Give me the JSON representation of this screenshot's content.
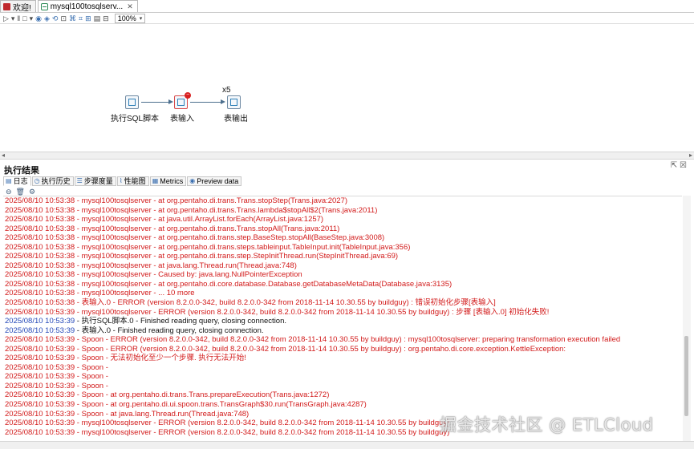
{
  "tabs": [
    {
      "label": "欢迎!",
      "icon": "welcome-icon"
    },
    {
      "label": "mysql100tosqlserv...",
      "icon": "transformation-icon",
      "close": "✕"
    }
  ],
  "toolbar": {
    "zoom": "100%"
  },
  "canvas": {
    "steps": [
      {
        "label": "执行SQL脚本",
        "icon": "sql-script-icon"
      },
      {
        "label": "表输入",
        "icon": "table-input-icon",
        "error_badge": "−"
      },
      {
        "label": "表输出",
        "icon": "table-output-icon",
        "copies": "x5"
      }
    ]
  },
  "results": {
    "title": "执行结果",
    "tabs": [
      {
        "label": "日志"
      },
      {
        "label": "执行历史"
      },
      {
        "label": "步骤度量"
      },
      {
        "label": "性能图"
      },
      {
        "label": "Metrics"
      },
      {
        "label": "Preview data"
      }
    ]
  },
  "log_lines": [
    {
      "text": "2025/08/10 10:53:38 - mysql100tosqlserver -  at org.pentaho.di.trans.Trans.stopStep(Trans.java:2027)",
      "color": "red"
    },
    {
      "text": "2025/08/10 10:53:38 - mysql100tosqlserver -  at org.pentaho.di.trans.Trans.lambda$stopAll$2(Trans.java:2011)",
      "color": "red"
    },
    {
      "text": "2025/08/10 10:53:38 - mysql100tosqlserver -  at java.util.ArrayList.forEach(ArrayList.java:1257)",
      "color": "red"
    },
    {
      "text": "2025/08/10 10:53:38 - mysql100tosqlserver -  at org.pentaho.di.trans.Trans.stopAll(Trans.java:2011)",
      "color": "red"
    },
    {
      "text": "2025/08/10 10:53:38 - mysql100tosqlserver -  at org.pentaho.di.trans.step.BaseStep.stopAll(BaseStep.java:3008)",
      "color": "red"
    },
    {
      "text": "2025/08/10 10:53:38 - mysql100tosqlserver -  at org.pentaho.di.trans.steps.tableinput.TableInput.init(TableInput.java:356)",
      "color": "red"
    },
    {
      "text": "2025/08/10 10:53:38 - mysql100tosqlserver -  at org.pentaho.di.trans.step.StepInitThread.run(StepInitThread.java:69)",
      "color": "red"
    },
    {
      "text": "2025/08/10 10:53:38 - mysql100tosqlserver -  at java.lang.Thread.run(Thread.java:748)",
      "color": "red"
    },
    {
      "text": "2025/08/10 10:53:38 - mysql100tosqlserver - Caused by: java.lang.NullPointerException",
      "color": "red"
    },
    {
      "text": "2025/08/10 10:53:38 - mysql100tosqlserver -  at org.pentaho.di.core.database.Database.getDatabaseMetaData(Database.java:3135)",
      "color": "red"
    },
    {
      "text": "2025/08/10 10:53:38 - mysql100tosqlserver -  ... 10 more",
      "color": "red"
    },
    {
      "text": "2025/08/10 10:53:38 - 表输入.0 - ERROR (version 8.2.0.0-342, build 8.2.0.0-342 from 2018-11-14 10.30.55 by buildguy) : 错误初始化步骤[表输入]",
      "color": "red"
    },
    {
      "text": "2025/08/10 10:53:39 - mysql100tosqlserver - ERROR (version 8.2.0.0-342, build 8.2.0.0-342 from 2018-11-14 10.30.55 by buildguy) : 步骤 [表输入.0] 初始化失败!",
      "color": "red"
    },
    {
      "ts": "2025/08/10 10:53:39",
      "rest": " - 执行SQL脚本.0 - Finished reading query, closing connection.",
      "color": "black"
    },
    {
      "ts": "2025/08/10 10:53:39",
      "rest": " - 表输入.0 - Finished reading query, closing connection.",
      "color": "black"
    },
    {
      "text": "2025/08/10 10:53:39 - Spoon - ERROR (version 8.2.0.0-342, build 8.2.0.0-342 from 2018-11-14 10.30.55 by buildguy) : mysql100tosqlserver: preparing transformation execution failed",
      "color": "red"
    },
    {
      "text": "2025/08/10 10:53:39 - Spoon - ERROR (version 8.2.0.0-342, build 8.2.0.0-342 from 2018-11-14 10.30.55 by buildguy) : org.pentaho.di.core.exception.KettleException:",
      "color": "red"
    },
    {
      "text": "2025/08/10 10:53:39 - Spoon - 无法初始化至少一个步骤.  执行无法开始!",
      "color": "red"
    },
    {
      "text": "2025/08/10 10:53:39 - Spoon -",
      "color": "red"
    },
    {
      "text": "2025/08/10 10:53:39 - Spoon -",
      "color": "red"
    },
    {
      "text": "2025/08/10 10:53:39 - Spoon -",
      "color": "red"
    },
    {
      "text": "2025/08/10 10:53:39 - Spoon -  at org.pentaho.di.trans.Trans.prepareExecution(Trans.java:1272)",
      "color": "red"
    },
    {
      "text": "2025/08/10 10:53:39 - Spoon -  at org.pentaho.di.ui.spoon.trans.TransGraph$30.run(TransGraph.java:4287)",
      "color": "red"
    },
    {
      "text": "2025/08/10 10:53:39 - Spoon -  at java.lang.Thread.run(Thread.java:748)",
      "color": "red"
    },
    {
      "text": "2025/08/10 10:53:39 - mysql100tosqlserver - ERROR (version 8.2.0.0-342, build 8.2.0.0-342 from 2018-11-14 10.30.55 by buildguy)",
      "color": "red"
    },
    {
      "text": "2025/08/10 10:53:39 - mysql100tosqlserver - ERROR (version 8.2.0.0-342, build 8.2.0.0-342 from 2018-11-14 10.30.55 by buildguy)",
      "color": "red"
    }
  ],
  "watermark": "掘金技术社区 @ ETLCloud",
  "colors": {
    "log_error": "#d21a1a",
    "log_normal": "#111111",
    "timestamp_blue": "#2448b8"
  }
}
